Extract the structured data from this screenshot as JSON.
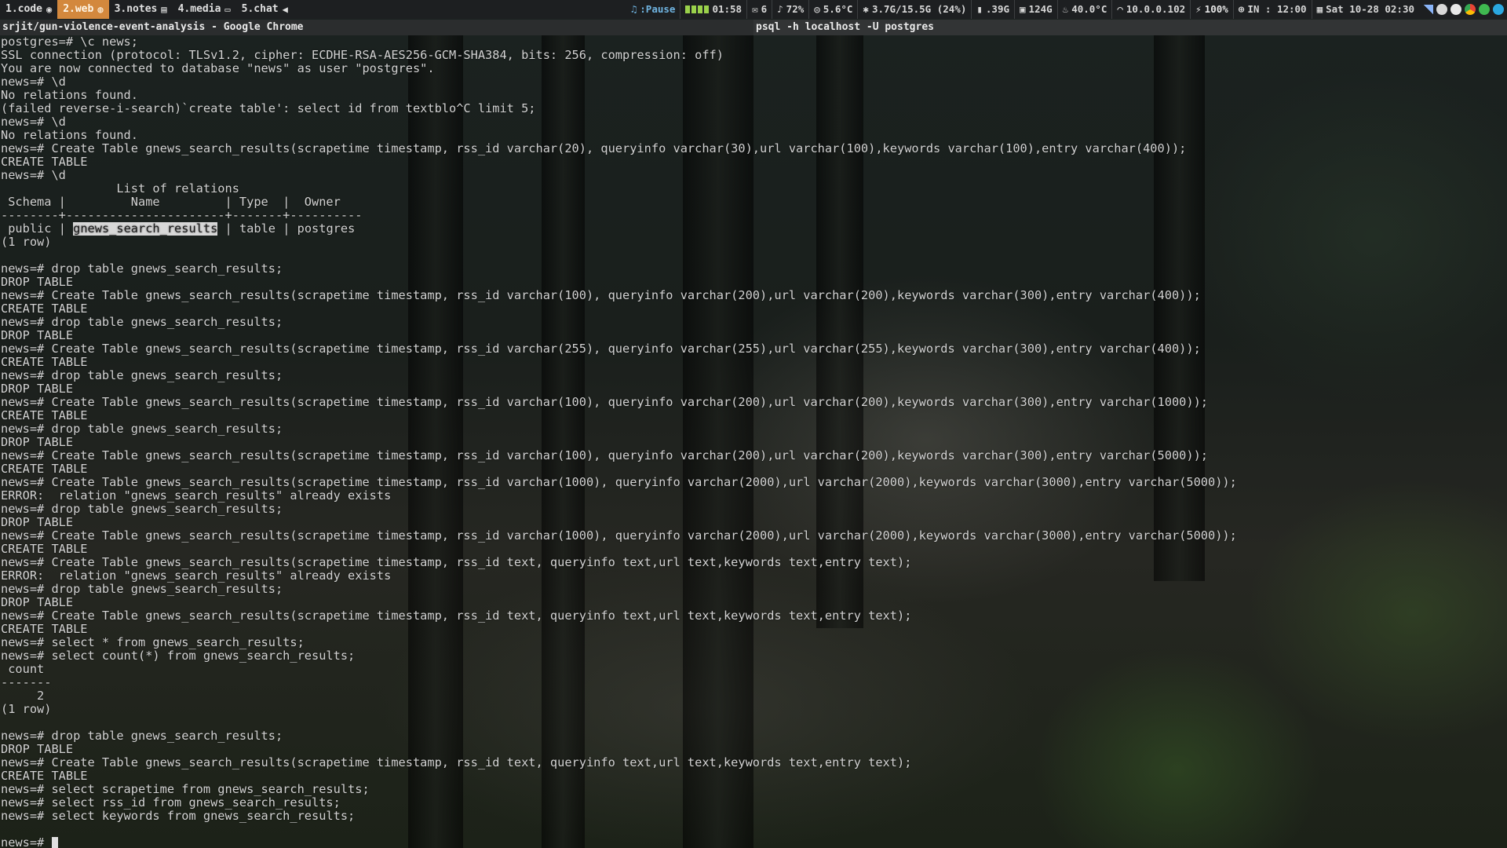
{
  "workspaces": [
    {
      "label": "1.code",
      "icon": "github-icon",
      "active": false
    },
    {
      "label": "2.web",
      "icon": "firefox-icon",
      "active": true
    },
    {
      "label": "3.notes",
      "icon": "notebook-icon",
      "active": false
    },
    {
      "label": "4.media",
      "icon": "folder-icon",
      "active": false
    },
    {
      "label": "5.chat",
      "icon": "telegram-icon",
      "active": false
    }
  ],
  "statusbar": {
    "media": ":Pause",
    "time_elapsed": "01:58",
    "mail": "6",
    "volume": "72%",
    "weather": "5.6°C",
    "memory": "3.7G/15.5G (24%)",
    "disk1": ".39G",
    "disk2": "124G",
    "cpu_temp": "40.0°C",
    "ip": "10.0.0.102",
    "battery": "100%",
    "tz": "IN : 12:00",
    "datetime": "Sat 10-28 02:30"
  },
  "windows": {
    "left_title": "srjit/gun-violence-event-analysis - Google Chrome",
    "right_title": "psql -h localhost -U postgres"
  },
  "terminal": {
    "lines": [
      "postgres=# \\c news;",
      "SSL connection (protocol: TLSv1.2, cipher: ECDHE-RSA-AES256-GCM-SHA384, bits: 256, compression: off)",
      "You are now connected to database \"news\" as user \"postgres\".",
      "news=# \\d",
      "No relations found.",
      "(failed reverse-i-search)`create table': select id from textblo^C limit 5;",
      "news=# \\d",
      "No relations found.",
      "news=# Create Table gnews_search_results(scrapetime timestamp, rss_id varchar(20), queryinfo varchar(30),url varchar(100),keywords varchar(100),entry varchar(400));",
      "CREATE TABLE",
      "news=# \\d",
      "                List of relations",
      " Schema |         Name         | Type  |  Owner",
      "--------+----------------------+-------+----------",
      "",
      "(1 row)",
      "",
      "news=# drop table gnews_search_results;",
      "DROP TABLE",
      "news=# Create Table gnews_search_results(scrapetime timestamp, rss_id varchar(100), queryinfo varchar(200),url varchar(200),keywords varchar(300),entry varchar(400));",
      "CREATE TABLE",
      "news=# drop table gnews_search_results;",
      "DROP TABLE",
      "news=# Create Table gnews_search_results(scrapetime timestamp, rss_id varchar(255), queryinfo varchar(255),url varchar(255),keywords varchar(300),entry varchar(400));",
      "CREATE TABLE",
      "news=# drop table gnews_search_results;",
      "DROP TABLE",
      "news=# Create Table gnews_search_results(scrapetime timestamp, rss_id varchar(100), queryinfo varchar(200),url varchar(200),keywords varchar(300),entry varchar(1000));",
      "CREATE TABLE",
      "news=# drop table gnews_search_results;",
      "DROP TABLE",
      "news=# Create Table gnews_search_results(scrapetime timestamp, rss_id varchar(100), queryinfo varchar(200),url varchar(200),keywords varchar(300),entry varchar(5000));",
      "CREATE TABLE",
      "news=# Create Table gnews_search_results(scrapetime timestamp, rss_id varchar(1000), queryinfo varchar(2000),url varchar(2000),keywords varchar(3000),entry varchar(5000));",
      "ERROR:  relation \"gnews_search_results\" already exists",
      "news=# drop table gnews_search_results;",
      "DROP TABLE",
      "news=# Create Table gnews_search_results(scrapetime timestamp, rss_id varchar(1000), queryinfo varchar(2000),url varchar(2000),keywords varchar(3000),entry varchar(5000));",
      "CREATE TABLE",
      "news=# Create Table gnews_search_results(scrapetime timestamp, rss_id text, queryinfo text,url text,keywords text,entry text);",
      "ERROR:  relation \"gnews_search_results\" already exists",
      "news=# drop table gnews_search_results;",
      "DROP TABLE",
      "news=# Create Table gnews_search_results(scrapetime timestamp, rss_id text, queryinfo text,url text,keywords text,entry text);",
      "CREATE TABLE",
      "news=# select * from gnews_search_results;",
      "news=# select count(*) from gnews_search_results;",
      " count",
      "-------",
      "     2",
      "(1 row)",
      "",
      "news=# drop table gnews_search_results;",
      "DROP TABLE",
      "news=# Create Table gnews_search_results(scrapetime timestamp, rss_id text, queryinfo text,url text,keywords text,entry text);",
      "CREATE TABLE",
      "news=# select scrapetime from gnews_search_results;",
      "news=# select rss_id from gnews_search_results;",
      "news=# select keywords from gnews_search_results;"
    ],
    "relation_row": {
      "schema": " public ",
      "name": "gnews_search_results",
      "rest": " | table | postgres"
    },
    "prompt": "news=# "
  }
}
